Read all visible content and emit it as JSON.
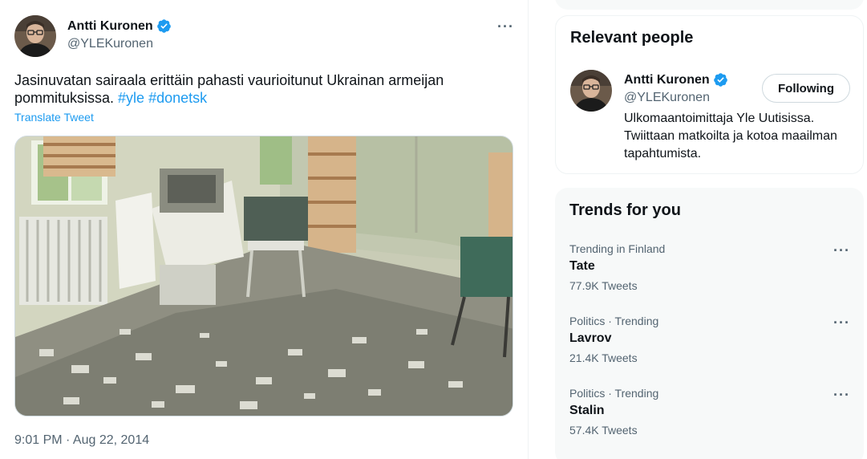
{
  "tweet": {
    "author_name": "Antti Kuronen",
    "author_handle": "@YLEKuronen",
    "text_plain": "Jasinuvatan sairaala erittäin pahasti vaurioitunut Ukrainan armeijan pommituksissa.",
    "hashtags": [
      "#yle",
      "#donetsk"
    ],
    "translate_label": "Translate Tweet",
    "timestamp": "9:01 PM · Aug 22, 2014",
    "more_label": "···",
    "media_icon": "hospital-room-photo"
  },
  "relevant_people": {
    "title": "Relevant people",
    "person": {
      "name": "Antti Kuronen",
      "handle": "@YLEKuronen",
      "follow_label": "Following",
      "bio": "Ulkomaantoimittaja Yle Uutisissa. Twiittaan matkoilta ja kotoa maailman tapahtumista."
    }
  },
  "trends": {
    "title": "Trends for you",
    "items": [
      {
        "context": "Trending in Finland",
        "name": "Tate",
        "count": "77.9K Tweets"
      },
      {
        "context": "Politics · Trending",
        "name": "Lavrov",
        "count": "21.4K Tweets"
      },
      {
        "context": "Politics · Trending",
        "name": "Stalin",
        "count": "57.4K Tweets"
      }
    ],
    "more_label": "···"
  },
  "colors": {
    "accent": "#1d9bf0",
    "secondary_text": "#536471",
    "primary_text": "#0f1419",
    "sidebar_bg": "#f7f9f9"
  }
}
